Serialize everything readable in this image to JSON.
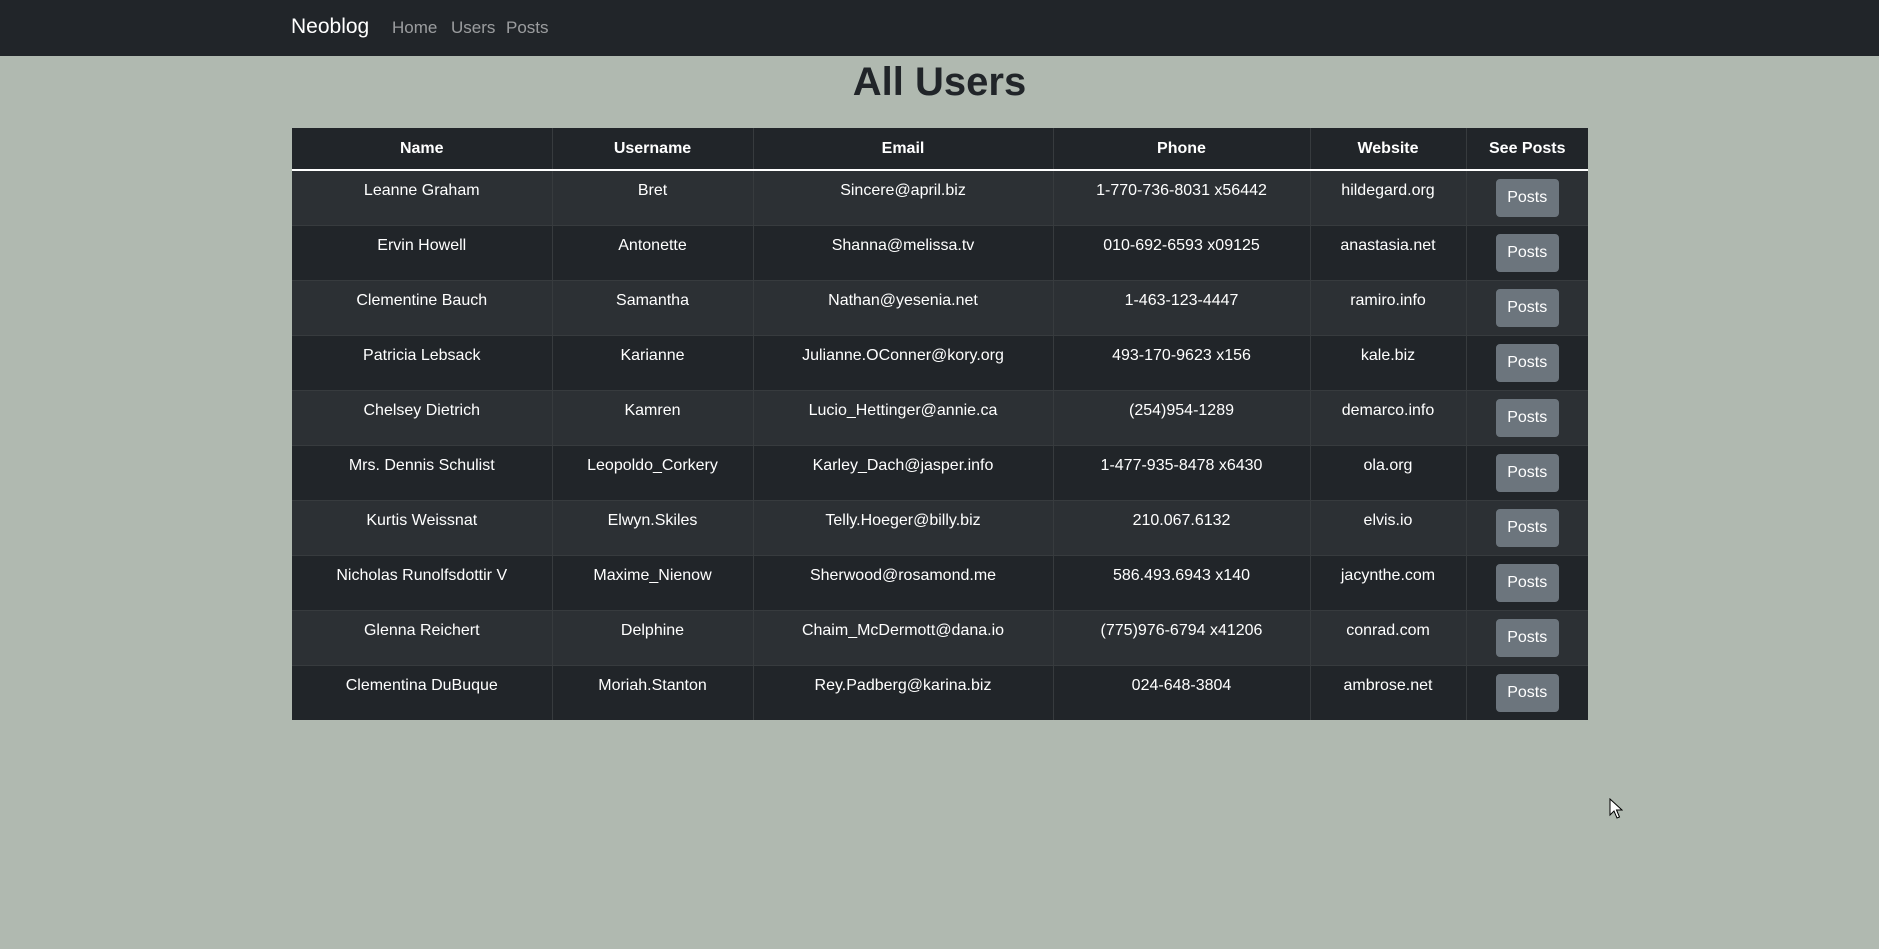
{
  "navbar": {
    "brand": "Neoblog",
    "links": [
      "Home",
      "Users",
      "Posts"
    ]
  },
  "page": {
    "title": "All Users"
  },
  "table": {
    "headers": [
      "Name",
      "Username",
      "Email",
      "Phone",
      "Website",
      "See Posts"
    ],
    "button_label": "Posts",
    "rows": [
      [
        "Leanne Graham",
        "Bret",
        "Sincere@april.biz",
        "1-770-736-8031 x56442",
        "hildegard.org"
      ],
      [
        "Ervin Howell",
        "Antonette",
        "Shanna@melissa.tv",
        "010-692-6593 x09125",
        "anastasia.net"
      ],
      [
        "Clementine Bauch",
        "Samantha",
        "Nathan@yesenia.net",
        "1-463-123-4447",
        "ramiro.info"
      ],
      [
        "Patricia Lebsack",
        "Karianne",
        "Julianne.OConner@kory.org",
        "493-170-9623 x156",
        "kale.biz"
      ],
      [
        "Chelsey Dietrich",
        "Kamren",
        "Lucio_Hettinger@annie.ca",
        "(254)954-1289",
        "demarco.info"
      ],
      [
        "Mrs. Dennis Schulist",
        "Leopoldo_Corkery",
        "Karley_Dach@jasper.info",
        "1-477-935-8478 x6430",
        "ola.org"
      ],
      [
        "Kurtis Weissnat",
        "Elwyn.Skiles",
        "Telly.Hoeger@billy.biz",
        "210.067.6132",
        "elvis.io"
      ],
      [
        "Nicholas Runolfsdottir V",
        "Maxime_Nienow",
        "Sherwood@rosamond.me",
        "586.493.6943 x140",
        "jacynthe.com"
      ],
      [
        "Glenna Reichert",
        "Delphine",
        "Chaim_McDermott@dana.io",
        "(775)976-6794 x41206",
        "conrad.com"
      ],
      [
        "Clementina DuBuque",
        "Moriah.Stanton",
        "Rey.Padberg@karina.biz",
        "024-648-3804",
        "ambrose.net"
      ]
    ]
  },
  "colors": {
    "navbar": "#212529",
    "background": "#b0b9b0",
    "row_odd": "#2c3034",
    "row_even": "#212529",
    "button": "#6c757d"
  },
  "icons": {
    "cursor": "mouse-pointer-icon"
  }
}
